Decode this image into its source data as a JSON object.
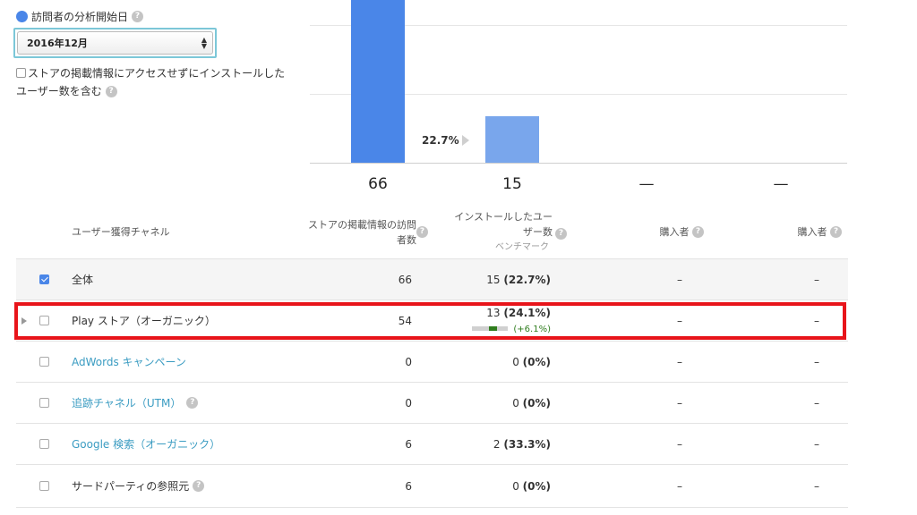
{
  "filters": {
    "start_label": "訪問者の分析開始日",
    "date_value": "2016年12月",
    "include_label": "ストアの掲載情報にアクセスせずにインストールしたユーザー数を含む"
  },
  "chart": {
    "conversion": "22.7%",
    "bar_colors": [
      "#4a86e8",
      "#79a6ec"
    ],
    "stage_values": [
      "66",
      "15",
      "—",
      "—"
    ]
  },
  "table": {
    "headers": {
      "channel": "ユーザー獲得チャネル",
      "visitors": "ストアの掲載情報の訪問者数",
      "installers": "インストールしたユーザー数",
      "benchmark": "ベンチマーク",
      "buyers1": "購入者",
      "buyers2": "購入者"
    },
    "rows": [
      {
        "name": "全体",
        "visitors": "66",
        "installs": "15",
        "pct": "(22.7%)",
        "buyers1": "–",
        "buyers2": "–",
        "checked": true
      },
      {
        "name": "Play ストア（オーガニック）",
        "visitors": "54",
        "installs": "13",
        "pct": "(24.1%)",
        "delta": "(+6.1%)",
        "buyers1": "–",
        "buyers2": "–"
      },
      {
        "name": "AdWords キャンペーン",
        "visitors": "0",
        "installs": "0",
        "pct": "(0%)",
        "buyers1": "–",
        "buyers2": "–"
      },
      {
        "name": "追跡チャネル（UTM）",
        "visitors": "0",
        "installs": "0",
        "pct": "(0%)",
        "buyers1": "–",
        "buyers2": "–"
      },
      {
        "name": "Google 検索（オーガニック）",
        "visitors": "6",
        "installs": "2",
        "pct": "(33.3%)",
        "buyers1": "–",
        "buyers2": "–"
      },
      {
        "name": "サードパーティの参照元",
        "visitors": "6",
        "installs": "0",
        "pct": "(0%)",
        "buyers1": "–",
        "buyers2": "–"
      }
    ]
  }
}
